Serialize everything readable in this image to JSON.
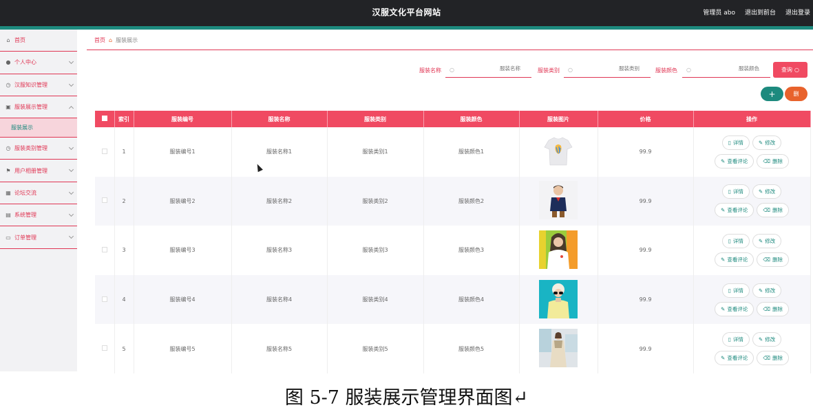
{
  "header": {
    "title": "汉服文化平台网站",
    "user": "管理员 abo",
    "back_front": "退出到前台",
    "logout": "退出登录"
  },
  "sidebar": {
    "items": [
      {
        "label": "首页",
        "icon": "home-icon"
      },
      {
        "label": "个人中心",
        "icon": "user-icon"
      },
      {
        "label": "汉服知识管理",
        "icon": "clock-icon"
      },
      {
        "label": "服装展示管理",
        "icon": "image-icon"
      },
      {
        "label": "服装类别管理",
        "icon": "clock-icon"
      },
      {
        "label": "用户相册管理",
        "icon": "flag-icon"
      },
      {
        "label": "论坛交流",
        "icon": "grid-icon"
      },
      {
        "label": "系统管理",
        "icon": "bag-icon"
      },
      {
        "label": "订单管理",
        "icon": "card-icon"
      }
    ],
    "sub_active": "服装展示"
  },
  "breadcrumb": {
    "home": "首页",
    "current": "服装展示"
  },
  "search": {
    "name_label": "服装名称",
    "name_placeholder": "服装名称",
    "type_label": "服装类别",
    "type_placeholder": "服装类别",
    "color_label": "服装颜色",
    "color_placeholder": "服装颜色",
    "query_label": "查询"
  },
  "toolbar": {
    "add_label": "+",
    "delete_label": "删"
  },
  "table": {
    "columns": [
      "索引",
      "服装编号",
      "服装名称",
      "服装类别",
      "服装颜色",
      "服装图片",
      "价格",
      "操作"
    ],
    "rows": [
      {
        "index": "1",
        "code": "服装编号1",
        "name": "服装名称1",
        "type": "服装类别1",
        "color": "服装颜色1",
        "price": "99.9",
        "image": "tshirt"
      },
      {
        "index": "2",
        "code": "服装编号2",
        "name": "服装名称2",
        "type": "服装类别2",
        "color": "服装颜色2",
        "price": "99.9",
        "image": "boy"
      },
      {
        "index": "3",
        "code": "服装编号3",
        "name": "服装名称3",
        "type": "服装类别3",
        "color": "服装颜色3",
        "price": "99.9",
        "image": "woman-green"
      },
      {
        "index": "4",
        "code": "服装编号4",
        "name": "服装名称4",
        "type": "服装类别4",
        "color": "服装颜色4",
        "price": "99.9",
        "image": "woman-teal"
      },
      {
        "index": "5",
        "code": "服装编号5",
        "name": "服装名称5",
        "type": "服装类别5",
        "color": "服装颜色5",
        "price": "99.9",
        "image": "woman-room"
      }
    ],
    "actions": {
      "detail": "详情",
      "edit": "修改",
      "comments": "查看评论",
      "delete": "删除"
    }
  },
  "caption": "图 5-7 服装展示管理界面图↵",
  "colors": {
    "accent": "#1d8a7e",
    "primary": "#f04a62",
    "header": "#222326"
  }
}
